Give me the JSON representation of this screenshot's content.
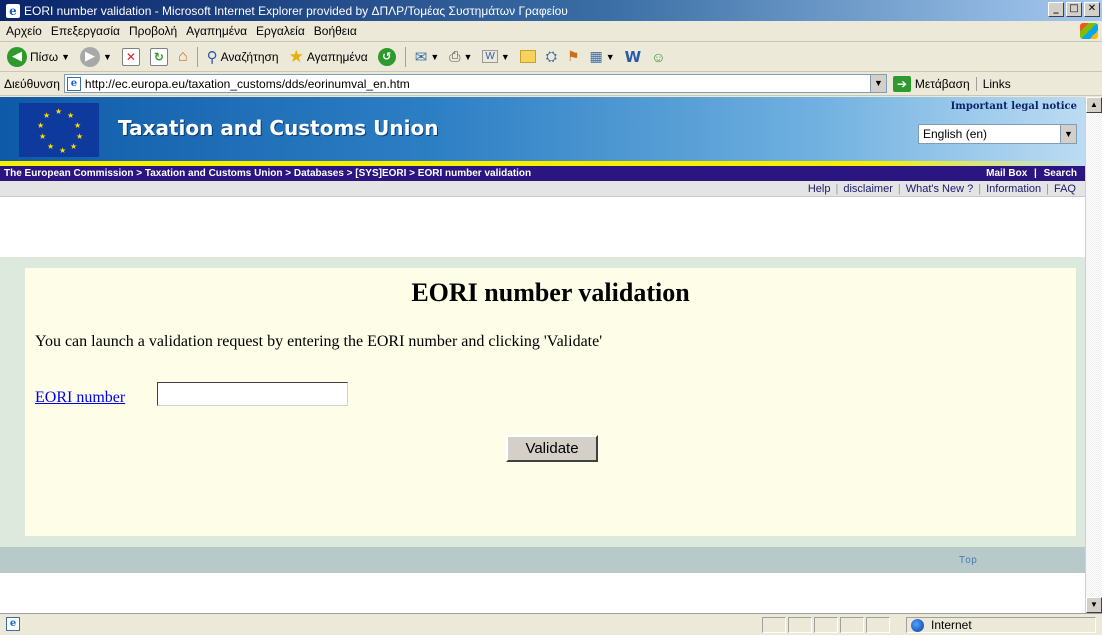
{
  "window": {
    "title": "EORI number validation - Microsoft Internet Explorer provided by ΔΠΛΡ/Τομέας Συστημάτων Γραφείου"
  },
  "menu": {
    "items": [
      {
        "label": "Αρχείο"
      },
      {
        "label": "Επεξεργασία"
      },
      {
        "label": "Προβολή"
      },
      {
        "label": "Αγαπημένα"
      },
      {
        "label": "Εργαλεία"
      },
      {
        "label": "Βοήθεια"
      }
    ]
  },
  "toolbar": {
    "back_label": "Πίσω",
    "search_label": "Αναζήτηση",
    "favorites_label": "Αγαπημένα"
  },
  "address": {
    "label": "Διεύθυνση",
    "url": "http://ec.europa.eu/taxation_customs/dds/eorinumval_en.htm",
    "go_label": "Μετάβαση",
    "links_label": "Links"
  },
  "site": {
    "title": "Taxation and Customs Union",
    "legal_notice": "Important legal notice",
    "language": "English (en)",
    "breadcrumb": "The European Commission > Taxation and Customs Union > Databases > [SYS]EORI > EORI number validation",
    "mailbox": "Mail Box",
    "search": "Search",
    "crumb_sep": "|",
    "subnav": [
      {
        "label": "Help"
      },
      {
        "label": "disclaimer"
      },
      {
        "label": "What's New ?"
      },
      {
        "label": "Information"
      },
      {
        "label": "FAQ"
      }
    ]
  },
  "content": {
    "heading": "EORI number validation",
    "instruction": "You can launch a validation request by entering the EORI number and clicking 'Validate'",
    "eori_label": "EORI number",
    "eori_value": "",
    "validate_label": "Validate",
    "top_link": "Top"
  },
  "status": {
    "zone": "Internet"
  }
}
